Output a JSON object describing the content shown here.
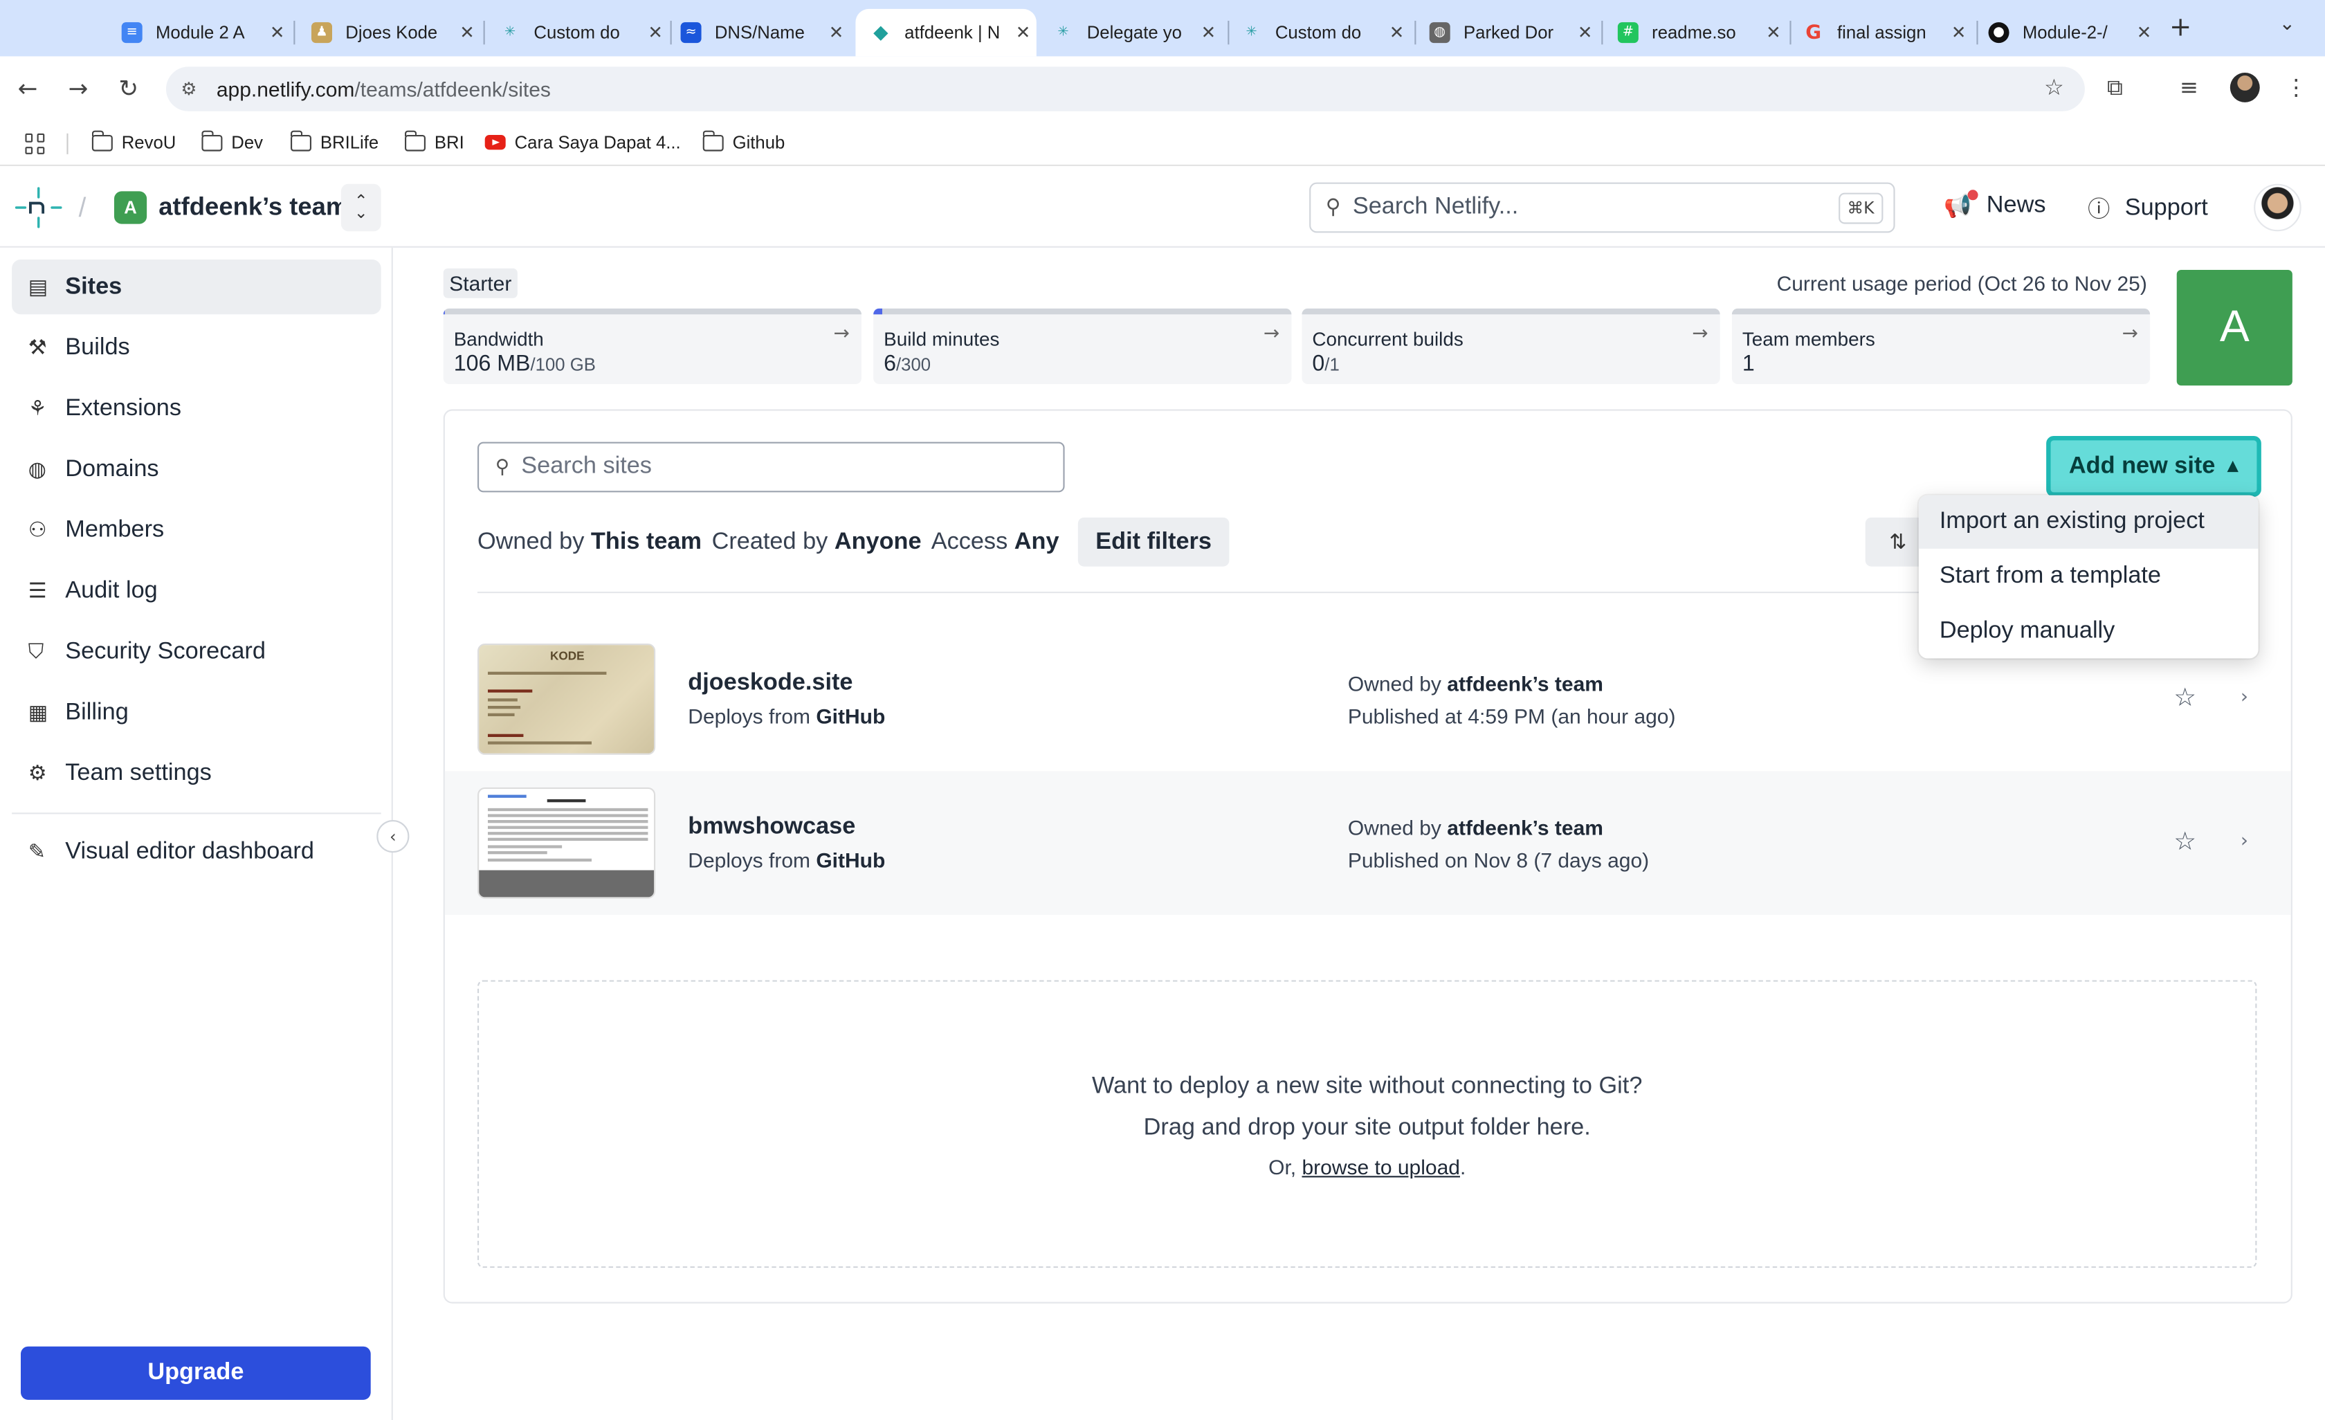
{
  "browser": {
    "tabs": [
      {
        "title": "Module 2 A",
        "icon": "docs-icon",
        "color": "#4285f4"
      },
      {
        "title": "Djoes Kode",
        "icon": "page-icon",
        "color": "#c8a45a"
      },
      {
        "title": "Custom do",
        "icon": "netlify-icon",
        "color": "#2c9fa5"
      },
      {
        "title": "DNS/Name",
        "icon": "dns-icon",
        "color": "#1a56db"
      },
      {
        "title": "atfdeenk | N",
        "icon": "netlify-diamond-icon",
        "color": "#20a09c"
      },
      {
        "title": "Delegate yo",
        "icon": "netlify-icon",
        "color": "#2c9fa5"
      },
      {
        "title": "Custom do",
        "icon": "netlify-icon",
        "color": "#2c9fa5"
      },
      {
        "title": "Parked Dor",
        "icon": "globe-icon",
        "color": "#666666"
      },
      {
        "title": "readme.so",
        "icon": "readme-icon",
        "color": "#22c55e"
      },
      {
        "title": "final assign",
        "icon": "google-icon",
        "color": "#ea4335"
      },
      {
        "title": "Module-2-/",
        "icon": "github-icon",
        "color": "#111111"
      }
    ],
    "url_host": "app.netlify.com",
    "url_path": "/teams/atfdeenk/sites",
    "bookmarks": [
      "RevoU",
      "Dev",
      "BRILife",
      "BRI",
      "Cara Saya Dapat 4...",
      "Github"
    ]
  },
  "header": {
    "team_badge": "A",
    "team_name": "atfdeenk’s team",
    "search_placeholder": "Search Netlify...",
    "search_shortcut": "⌘K",
    "news_label": "News",
    "support_label": "Support"
  },
  "sidebar": {
    "items": [
      {
        "label": "Sites",
        "icon": "sites-icon"
      },
      {
        "label": "Builds",
        "icon": "builds-icon"
      },
      {
        "label": "Extensions",
        "icon": "extensions-icon"
      },
      {
        "label": "Domains",
        "icon": "globe-icon"
      },
      {
        "label": "Members",
        "icon": "members-icon"
      },
      {
        "label": "Audit log",
        "icon": "audit-log-icon"
      },
      {
        "label": "Security Scorecard",
        "icon": "shield-icon"
      },
      {
        "label": "Billing",
        "icon": "billing-icon"
      },
      {
        "label": "Team settings",
        "icon": "gear-icon"
      }
    ],
    "visual_editor": "Visual editor dashboard",
    "upgrade_label": "Upgrade"
  },
  "usage": {
    "plan": "Starter",
    "period": "Current usage period (Oct 26 to Nov 25)",
    "cards": [
      {
        "label": "Bandwidth",
        "value": "106 MB",
        "limit": "/100 GB",
        "fill": 0.001
      },
      {
        "label": "Build minutes",
        "value": "6",
        "limit": "/300",
        "fill": 0.02
      },
      {
        "label": "Concurrent builds",
        "value": "0",
        "limit": "/1",
        "fill": 0
      },
      {
        "label": "Team members",
        "value": "1",
        "limit": "",
        "fill": 0
      }
    ],
    "avatar_letter": "A"
  },
  "sites": {
    "search_placeholder": "Search sites",
    "add_label": "Add new site",
    "filters": {
      "owned_label": "Owned by",
      "owned_value": "This team",
      "created_label": "Created by",
      "created_value": "Anyone",
      "access_label": "Access",
      "access_value": "Any",
      "edit_label": "Edit filters"
    },
    "menu": [
      "Import an existing project",
      "Start from a template",
      "Deploy manually"
    ],
    "list": [
      {
        "name": "djoeskode.site",
        "deploy_prefix": "Deploys from",
        "deploy_src": "GitHub",
        "owner_prefix": "Owned by",
        "owner": "atfdeenk’s team",
        "published": "Published at 4:59 PM (an hour ago)"
      },
      {
        "name": "bmwshowcase",
        "deploy_prefix": "Deploys from",
        "deploy_src": "GitHub",
        "owner_prefix": "Owned by",
        "owner": "atfdeenk’s team",
        "published": "Published on Nov 8 (7 days ago)"
      }
    ],
    "thumb_title": "KODE",
    "drop": {
      "line1": "Want to deploy a new site without connecting to Git?",
      "line2": "Drag and drop your site output folder here.",
      "line3_prefix": "Or,",
      "line3_link": "browse to upload",
      "line3_suffix": "."
    }
  }
}
